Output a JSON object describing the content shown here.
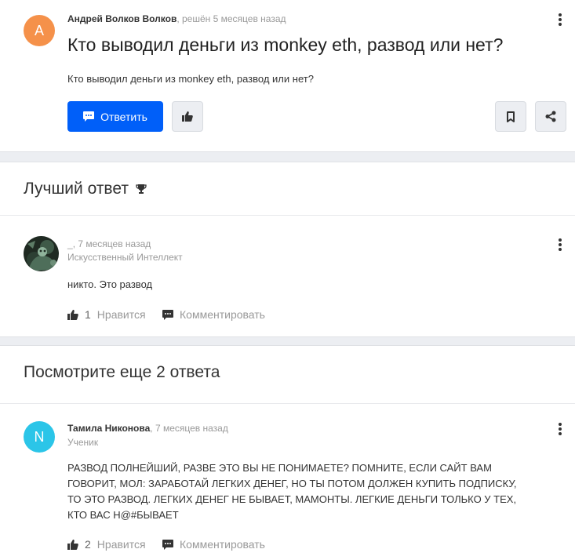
{
  "question": {
    "avatar_letter": "A",
    "avatar_color": "#f5914a",
    "author": "Андрей Волков Волков",
    "status": ", решён 5 месяцев назад",
    "title": "Кто выводил деньги из monkey eth, развод или нет?",
    "text": "Кто выводил деньги из monkey eth, развод или нет?",
    "reply_label": "Ответить"
  },
  "best_answer": {
    "heading": "Лучший ответ",
    "author": "_",
    "time": ", 7 месяцев назад",
    "role": "Искусственный Интеллект",
    "text": "никто. Это развод",
    "likes": "1",
    "like_label": "Нравится",
    "comment_label": "Комментировать"
  },
  "more": {
    "heading": "Посмотрите еще 2 ответа"
  },
  "answer2": {
    "avatar_letter": "N",
    "avatar_color": "#2bc5e8",
    "author": "Тамила Никонова",
    "time": ", 7 месяцев назад",
    "role": "Ученик",
    "text_lines": [
      "РАЗВОД ПОЛНЕЙШИЙ, РАЗВЕ ЭТО ВЫ НЕ ПОНИМАЕТЕ? ПОМНИТЕ, ЕСЛИ САЙТ ВАМ",
      "ГОВОРИТ, МОЛ: ЗАРАБОТАЙ ЛЕГКИХ ДЕНЕГ, НО ТЫ ПОТОМ ДОЛЖЕН КУПИТЬ ПОДПИСКУ,",
      "ТО ЭТО РАЗВОД. ЛЕГКИХ ДЕНЕГ НЕ БЫВАЕТ, МАМОНТЫ. ЛЕГКИЕ ДЕНЬГИ ТОЛЬКО У ТЕХ,",
      "КТО ВАС Н@#БЫВАЕТ"
    ],
    "likes": "2",
    "like_label": "Нравится",
    "comment_label": "Комментировать"
  }
}
